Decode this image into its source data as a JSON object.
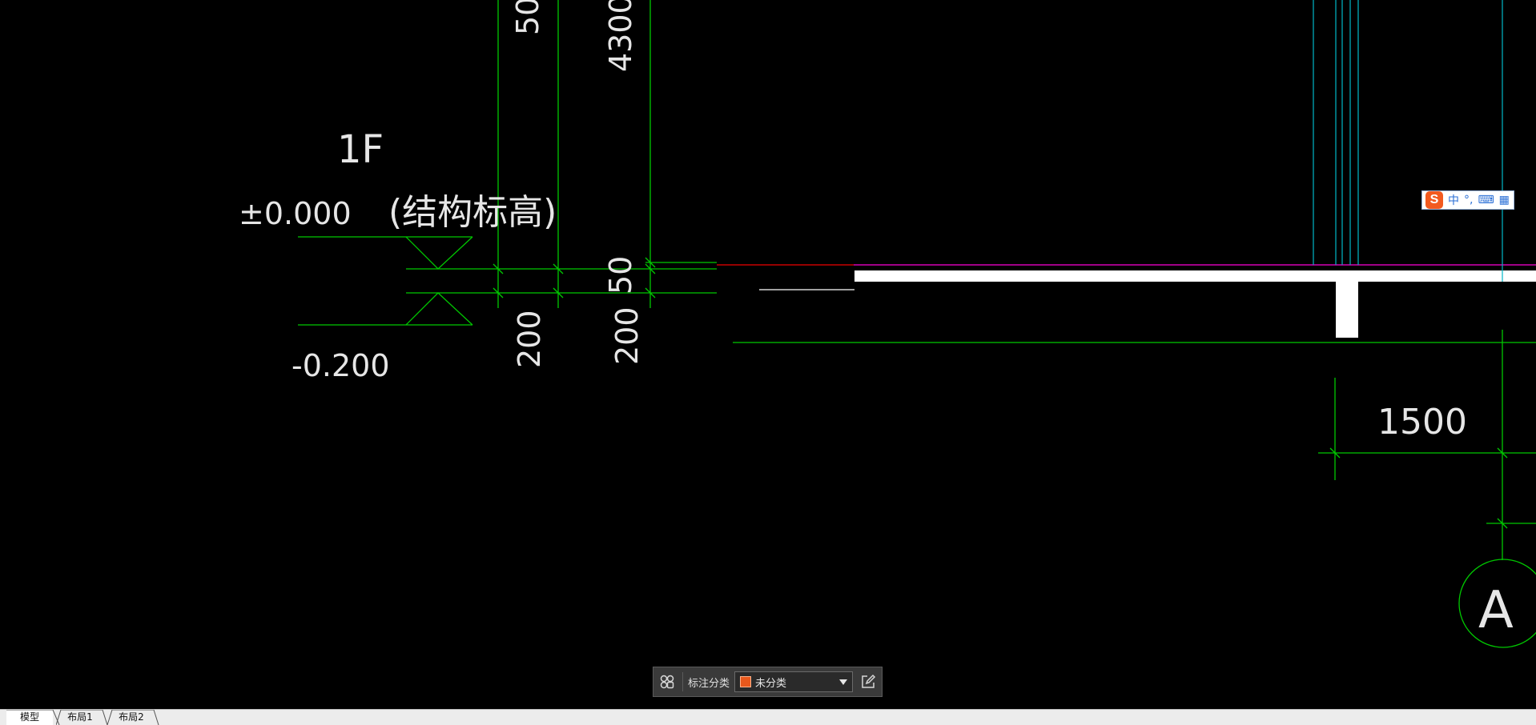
{
  "drawing": {
    "level_name": "1F",
    "elevation_top": "±0.000",
    "elevation_note": "(结构标高)",
    "elevation_bottom": "-0.200",
    "dim_500": "50",
    "dim_4300": "4300",
    "dim_50": "50",
    "dim_200_left": "200",
    "dim_200_right": "200",
    "dim_1500": "1500",
    "axis_label": "A"
  },
  "ime": {
    "mode": "中",
    "punct": "°,",
    "keyboard": "⌨",
    "menu": "▦"
  },
  "annotation_bar": {
    "category_label": "标注分类",
    "category_value": "未分类",
    "swatch_color": "#e8581c"
  },
  "tabs": [
    {
      "label": "模型",
      "active": true
    },
    {
      "label": "布局1",
      "active": false
    },
    {
      "label": "布局2",
      "active": false
    }
  ],
  "colors": {
    "background": "#000000",
    "green": "#00c800",
    "cyan": "#00b8c8",
    "magenta": "#b400b4",
    "red": "#c80000",
    "white": "#ffffff"
  }
}
